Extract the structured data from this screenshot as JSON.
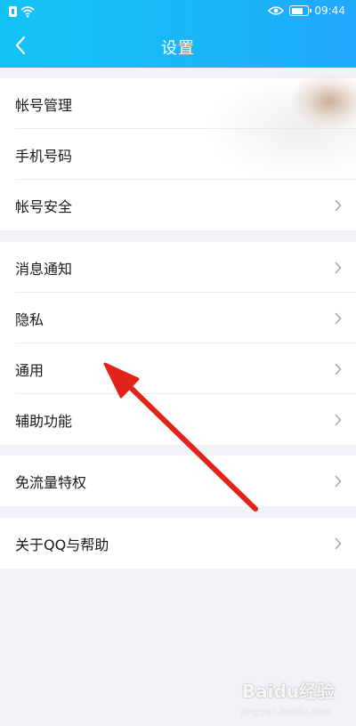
{
  "status_bar": {
    "time": "09:44"
  },
  "header": {
    "title": "设置",
    "back_icon": "chevron-left-icon"
  },
  "groups": [
    {
      "items": [
        {
          "label": "帐号管理",
          "has_chevron": false
        },
        {
          "label": "手机号码",
          "has_chevron": false
        },
        {
          "label": "帐号安全",
          "has_chevron": true
        }
      ]
    },
    {
      "items": [
        {
          "label": "消息通知",
          "has_chevron": true
        },
        {
          "label": "隐私",
          "has_chevron": true
        },
        {
          "label": "通用",
          "has_chevron": true
        },
        {
          "label": "辅助功能",
          "has_chevron": true
        }
      ]
    },
    {
      "items": [
        {
          "label": "免流量特权",
          "has_chevron": true
        }
      ]
    },
    {
      "items": [
        {
          "label": "关于QQ与帮助",
          "has_chevron": true
        }
      ]
    }
  ],
  "watermark": {
    "text": "Baidu经验",
    "sub": "jingyan.baidu.com"
  },
  "colors": {
    "header_start": "#12c3f5",
    "header_end": "#20a8fb",
    "background": "#f2f3f7",
    "annotation_arrow": "#e2231a"
  }
}
